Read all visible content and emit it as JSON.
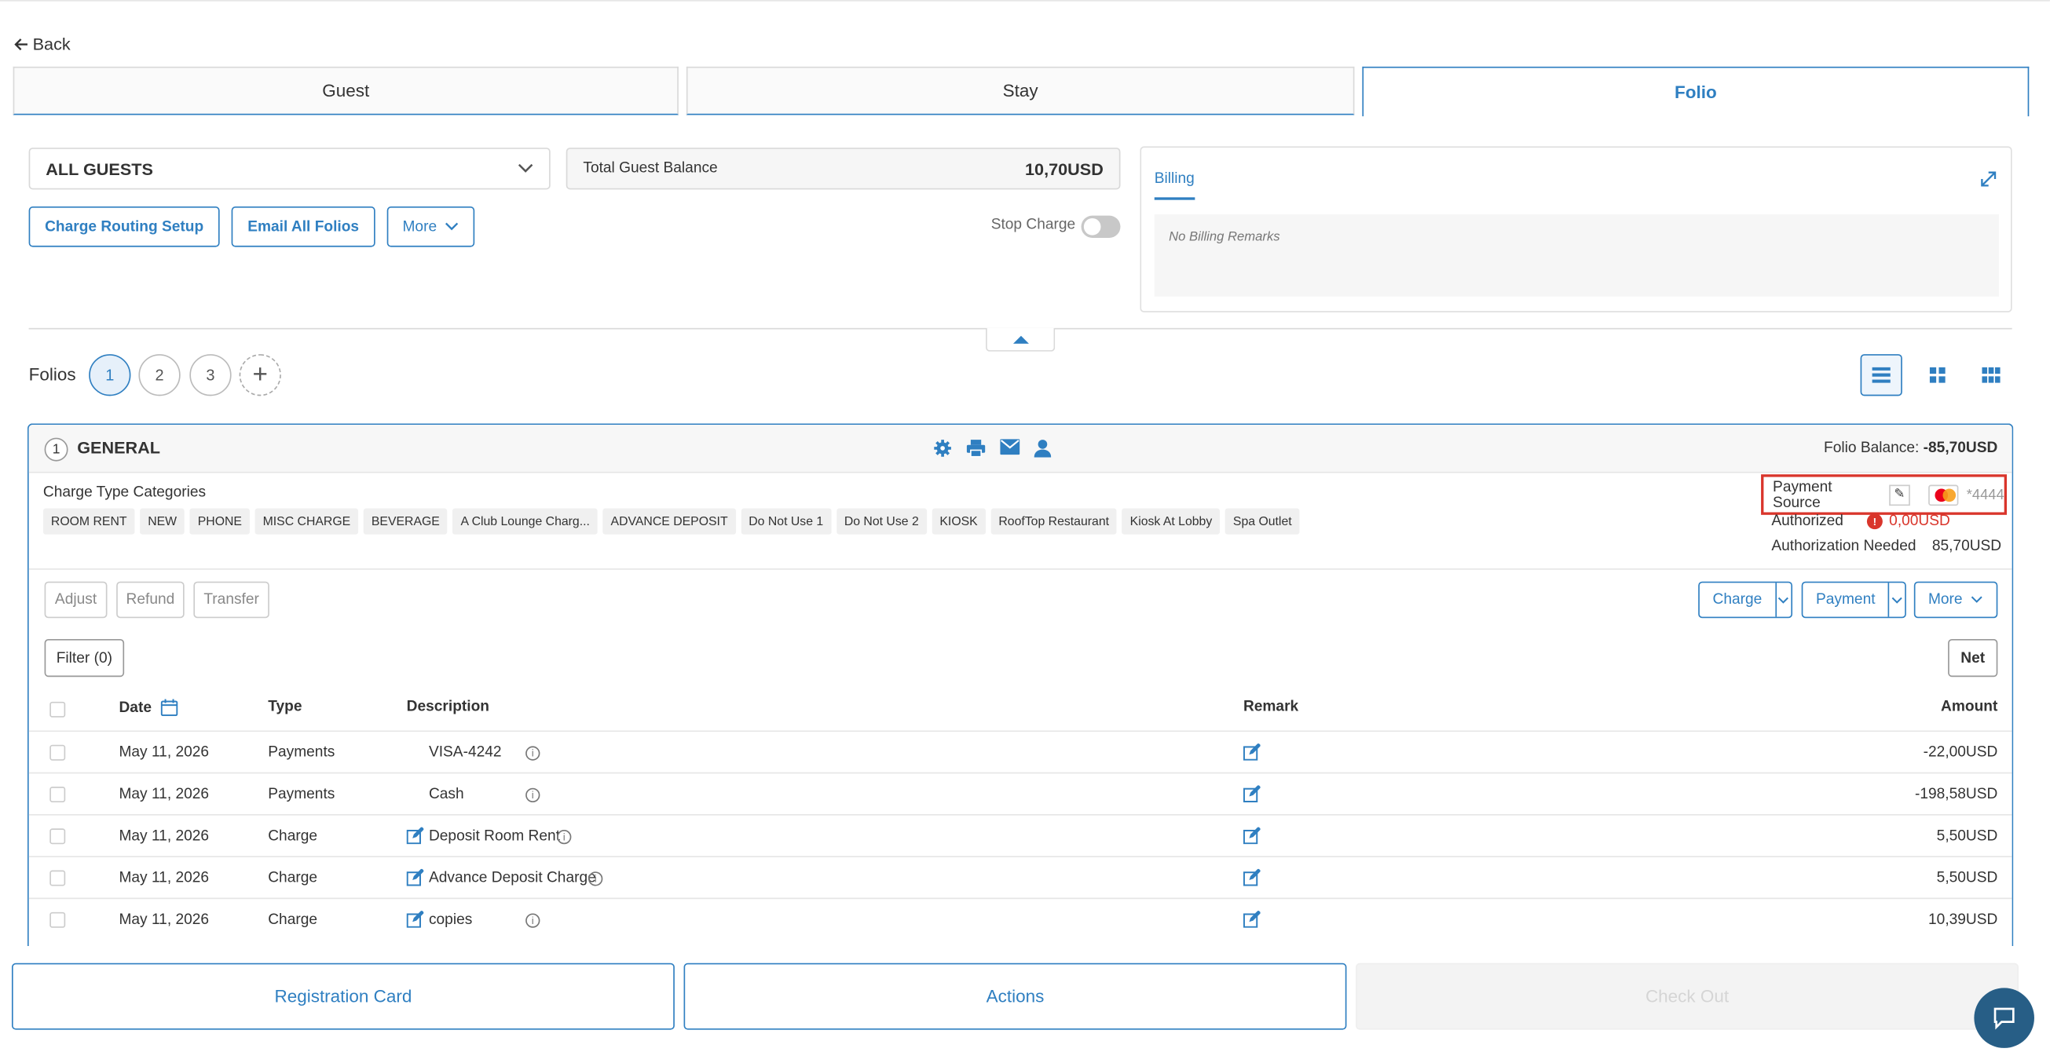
{
  "nav": {
    "back_label": "Back"
  },
  "tabs": [
    {
      "label": "Guest"
    },
    {
      "label": "Stay"
    },
    {
      "label": "Folio"
    }
  ],
  "guest_select": {
    "value": "ALL GUESTS"
  },
  "balance": {
    "label": "Total Guest Balance",
    "value": "10,70USD"
  },
  "actions": {
    "charge_routing": "Charge Routing Setup",
    "email_all": "Email All Folios",
    "more": "More"
  },
  "stop_charge": {
    "label": "Stop Charge",
    "on": false
  },
  "billing": {
    "tab": "Billing",
    "remarks": "No Billing Remarks"
  },
  "folios": {
    "label": "Folios",
    "items": [
      "1",
      "2",
      "3"
    ],
    "active": "1"
  },
  "folio": {
    "number": "1",
    "name": "GENERAL",
    "balance_label": "Folio Balance:",
    "balance_value": "-85,70USD",
    "charge_type_label": "Charge Type Categories",
    "categories": [
      "ROOM RENT",
      "NEW",
      "PHONE",
      "MISC CHARGE",
      "BEVERAGE",
      "A Club Lounge Charg...",
      "ADVANCE DEPOSIT",
      "Do Not Use 1",
      "Do Not Use 2",
      "KIOSK",
      "RoofTop Restaurant",
      "Kiosk At Lobby",
      "Spa Outlet"
    ],
    "payment_source_label": "Payment Source",
    "card_last4": "*4444",
    "authorized_label": "Authorized",
    "authorized_value": "0,00USD",
    "auth_needed_label": "Authorization Needed",
    "auth_needed_value": "85,70USD"
  },
  "toolbar": {
    "adjust": "Adjust",
    "refund": "Refund",
    "transfer": "Transfer",
    "charge": "Charge",
    "payment": "Payment",
    "more": "More",
    "filter": "Filter (0)",
    "net": "Net"
  },
  "table": {
    "headers": {
      "date": "Date",
      "type": "Type",
      "description": "Description",
      "remark": "Remark",
      "amount": "Amount"
    },
    "rows": [
      {
        "date": "May 11, 2026",
        "type": "Payments",
        "description": "VISA-4242",
        "amount": "-22,00USD"
      },
      {
        "date": "May 11, 2026",
        "type": "Payments",
        "description": "Cash",
        "amount": "-198,58USD"
      },
      {
        "date": "May 11, 2026",
        "type": "Charge",
        "description": "Deposit Room Rent",
        "amount": "5,50USD"
      },
      {
        "date": "May 11, 2026",
        "type": "Charge",
        "description": "Advance Deposit Charge",
        "amount": "5,50USD"
      },
      {
        "date": "May 11, 2026",
        "type": "Charge",
        "description": "copies",
        "amount": "10,39USD"
      }
    ]
  },
  "footer": {
    "registration_card": "Registration Card",
    "actions": "Actions",
    "check_out": "Check Out"
  },
  "colors": {
    "accent": "#2f7fc1",
    "alert": "#d9352b",
    "chat": "#275e86"
  }
}
